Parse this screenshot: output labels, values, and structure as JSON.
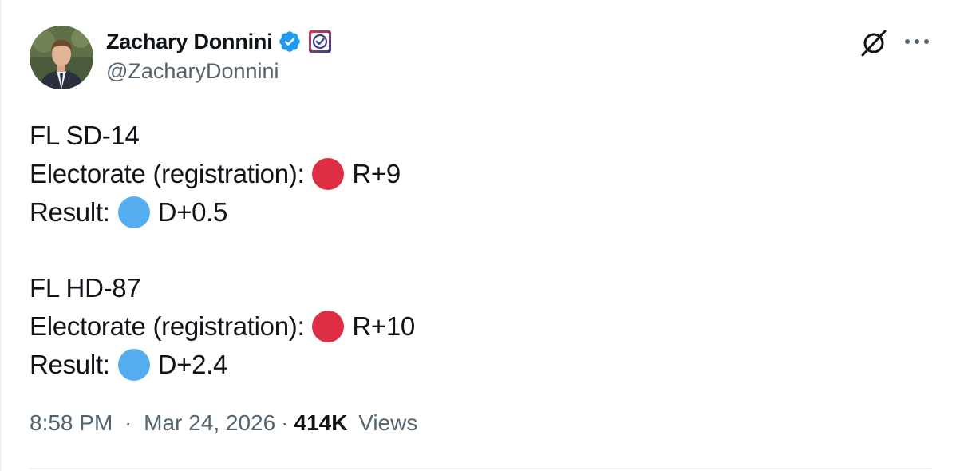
{
  "tweet": {
    "author": {
      "display_name": "Zachary Donnini",
      "handle": "@ZacharyDonnini",
      "verified_icon": "verified-badge-icon",
      "affiliate_icon": "affiliate-badge-icon"
    },
    "actions": {
      "grok_icon": "grok-icon",
      "more_icon": "more-options-icon"
    },
    "blocks": [
      {
        "district": "FL SD-14",
        "electorate_label": "Electorate (registration):",
        "electorate_value": "R+9",
        "result_label": "Result:",
        "result_value": "D+0.5"
      },
      {
        "district": "FL HD-87",
        "electorate_label": "Electorate (registration):",
        "electorate_value": "R+10",
        "result_label": "Result:",
        "result_value": "D+2.4"
      }
    ],
    "meta": {
      "time": "8:58 PM",
      "separator": "·",
      "date": "Mar 24, 2026",
      "views_count": "414K",
      "views_label": "Views"
    },
    "colors": {
      "red_circle": "#dd2e44",
      "blue_circle": "#55acee",
      "verified_blue": "#1d9bf0",
      "text_primary": "#0f1419",
      "text_secondary": "#536471"
    }
  }
}
